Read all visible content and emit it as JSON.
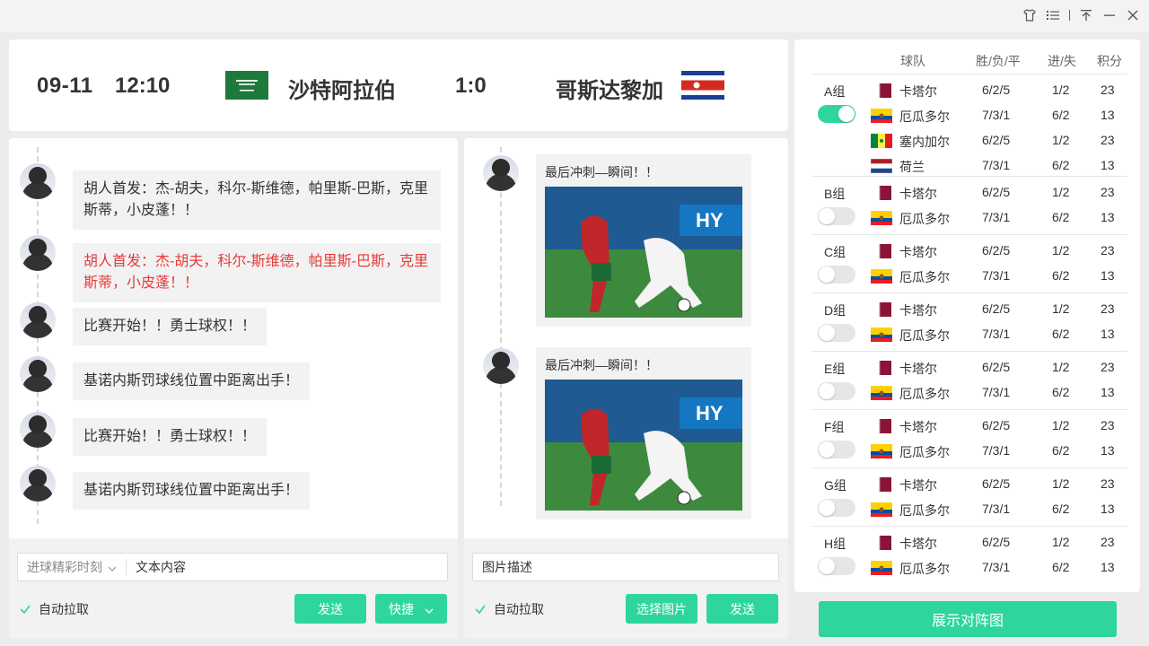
{
  "colors": {
    "accent": "#2ed59f",
    "alert_text": "#e63b3b"
  },
  "window": {
    "icons": [
      "shirt-icon",
      "list-icon",
      "pin-top-icon",
      "minimize-icon",
      "close-icon"
    ]
  },
  "match": {
    "date": "09-11",
    "time": "12:10",
    "home_team": "沙特阿拉伯",
    "score": "1:0",
    "away_team": "哥斯达黎加"
  },
  "text_feed": {
    "messages": [
      {
        "text": "胡人首发：杰-胡夫，科尔-斯维德，帕里斯-巴斯，克里斯蒂，小皮蓬！！",
        "highlight": false
      },
      {
        "text": "胡人首发：杰-胡夫，科尔-斯维德，帕里斯-巴斯，克里斯蒂，小皮蓬！！",
        "highlight": true
      },
      {
        "text": "比赛开始！！勇士球权！！",
        "highlight": false
      },
      {
        "text": "基诺内斯罚球线位置中距离出手！",
        "highlight": false
      },
      {
        "text": "比赛开始！！勇士球权！！",
        "highlight": false
      },
      {
        "text": "基诺内斯罚球线位置中距离出手！",
        "highlight": false
      }
    ],
    "compose": {
      "category": "进球精彩时刻",
      "input_value": "文本内容",
      "auto_fetch_label": "自动拉取",
      "auto_fetch_checked": true,
      "send_label": "发送",
      "quick_label": "快捷"
    }
  },
  "image_feed": {
    "messages": [
      {
        "caption": "最后冲刺—瞬间！！"
      },
      {
        "caption": "最后冲刺—瞬间！！"
      }
    ],
    "compose": {
      "input_value": "图片描述",
      "auto_fetch_label": "自动拉取",
      "auto_fetch_checked": true,
      "choose_image_label": "选择图片",
      "send_label": "发送"
    }
  },
  "standings": {
    "headers": {
      "team": "球队",
      "wdl": "胜/负/平",
      "goals": "进/失",
      "points": "积分"
    },
    "groups": [
      {
        "name": "A组",
        "enabled": true,
        "rows": [
          {
            "team": "卡塔尔",
            "flag": "qatar",
            "wdl": "6/2/5",
            "goals": "1/2",
            "points": "23"
          },
          {
            "team": "厄瓜多尔",
            "flag": "ecuador",
            "wdl": "7/3/1",
            "goals": "6/2",
            "points": "13"
          },
          {
            "team": "塞内加尔",
            "flag": "senegal",
            "wdl": "6/2/5",
            "goals": "1/2",
            "points": "23"
          },
          {
            "team": "荷兰",
            "flag": "netherlands",
            "wdl": "7/3/1",
            "goals": "6/2",
            "points": "13"
          }
        ]
      },
      {
        "name": "B组",
        "enabled": false,
        "rows": [
          {
            "team": "卡塔尔",
            "flag": "qatar",
            "wdl": "6/2/5",
            "goals": "1/2",
            "points": "23"
          },
          {
            "team": "厄瓜多尔",
            "flag": "ecuador",
            "wdl": "7/3/1",
            "goals": "6/2",
            "points": "13"
          }
        ]
      },
      {
        "name": "C组",
        "enabled": false,
        "rows": [
          {
            "team": "卡塔尔",
            "flag": "qatar",
            "wdl": "6/2/5",
            "goals": "1/2",
            "points": "23"
          },
          {
            "team": "厄瓜多尔",
            "flag": "ecuador",
            "wdl": "7/3/1",
            "goals": "6/2",
            "points": "13"
          }
        ]
      },
      {
        "name": "D组",
        "enabled": false,
        "rows": [
          {
            "team": "卡塔尔",
            "flag": "qatar",
            "wdl": "6/2/5",
            "goals": "1/2",
            "points": "23"
          },
          {
            "team": "厄瓜多尔",
            "flag": "ecuador",
            "wdl": "7/3/1",
            "goals": "6/2",
            "points": "13"
          }
        ]
      },
      {
        "name": "E组",
        "enabled": false,
        "rows": [
          {
            "team": "卡塔尔",
            "flag": "qatar",
            "wdl": "6/2/5",
            "goals": "1/2",
            "points": "23"
          },
          {
            "team": "厄瓜多尔",
            "flag": "ecuador",
            "wdl": "7/3/1",
            "goals": "6/2",
            "points": "13"
          }
        ]
      },
      {
        "name": "F组",
        "enabled": false,
        "rows": [
          {
            "team": "卡塔尔",
            "flag": "qatar",
            "wdl": "6/2/5",
            "goals": "1/2",
            "points": "23"
          },
          {
            "team": "厄瓜多尔",
            "flag": "ecuador",
            "wdl": "7/3/1",
            "goals": "6/2",
            "points": "13"
          }
        ]
      },
      {
        "name": "G组",
        "enabled": false,
        "rows": [
          {
            "team": "卡塔尔",
            "flag": "qatar",
            "wdl": "6/2/5",
            "goals": "1/2",
            "points": "23"
          },
          {
            "team": "厄瓜多尔",
            "flag": "ecuador",
            "wdl": "7/3/1",
            "goals": "6/2",
            "points": "13"
          }
        ]
      },
      {
        "name": "H组",
        "enabled": false,
        "rows": [
          {
            "team": "卡塔尔",
            "flag": "qatar",
            "wdl": "6/2/5",
            "goals": "1/2",
            "points": "23"
          },
          {
            "team": "厄瓜多尔",
            "flag": "ecuador",
            "wdl": "7/3/1",
            "goals": "6/2",
            "points": "13"
          }
        ]
      }
    ],
    "show_lineup_label": "展示对阵图"
  }
}
